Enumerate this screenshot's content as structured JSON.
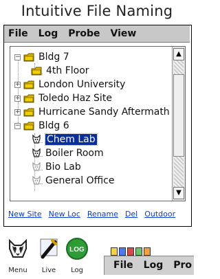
{
  "page_title": "Intuitive File Naming",
  "menubar": {
    "items": [
      "File",
      "Log",
      "Probe",
      "View"
    ]
  },
  "tree": {
    "items": [
      {
        "label": "Bldg 7",
        "expanded": true,
        "icon": "folder-icon"
      },
      {
        "label": "4th Floor",
        "icon": "folder-icon"
      },
      {
        "label": "London University",
        "expanded": false,
        "icon": "folder-icon"
      },
      {
        "label": "Toledo Haz Site",
        "expanded": false,
        "icon": "folder-icon"
      },
      {
        "label": "Hurricane Sandy Aftermath",
        "expanded": false,
        "icon": "folder-icon"
      },
      {
        "label": "Bldg 6",
        "expanded": true,
        "icon": "folder-icon"
      },
      {
        "label": "Chem Lab",
        "selected": true,
        "icon": "probe-icon"
      },
      {
        "label": "Boiler Room",
        "icon": "probe-icon"
      },
      {
        "label": "Bio Lab",
        "icon": "probe-icon-faded"
      },
      {
        "label": "General Office",
        "icon": "probe-icon-faded"
      }
    ]
  },
  "action_links": [
    "New Site",
    "New Loc",
    "Rename",
    "Del",
    "Outdoor"
  ],
  "bottom_toolbar": {
    "menu_label": "Menu",
    "live_label": "Live",
    "log_label": "Log",
    "log_badge": "LOG"
  },
  "sub_menubar": {
    "items": [
      "File",
      "Log",
      "Pro"
    ]
  },
  "colors": {
    "menubar_bg": "#c8c8c8",
    "selection": "#0b2f9a",
    "link": "#0b3bd1",
    "folder": "#d8b000",
    "log_green": "#2e9b37"
  }
}
